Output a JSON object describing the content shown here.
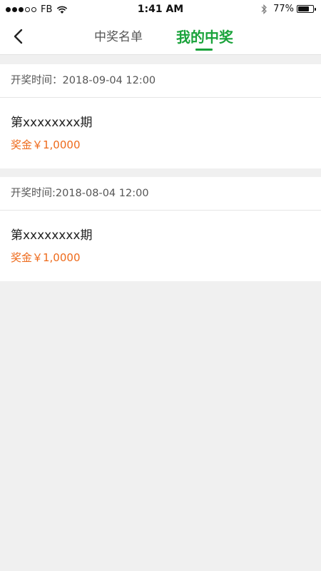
{
  "status_bar": {
    "carrier": "FB",
    "time": "1:41 AM",
    "battery_percent": "77%",
    "signal_bars_filled": 3,
    "signal_bars_total": 5,
    "battery_level": 0.77
  },
  "nav": {
    "back_icon": "chevron-left-icon",
    "tabs": [
      {
        "label": "中奖名单",
        "active": false
      },
      {
        "label": "我的中奖",
        "active": true
      }
    ],
    "accent_color": "#1aa33b"
  },
  "records": [
    {
      "draw_time_label": "开奖时间：2018-09-04 12:00",
      "period": "第xxxxxxxx期",
      "prize": "奖金￥1,0000"
    },
    {
      "draw_time_label": "开奖时间:2018-08-04 12:00",
      "period": "第xxxxxxxx期",
      "prize": "奖金￥1,0000"
    }
  ],
  "colors": {
    "prize": "#ee6a1b",
    "background": "#f0f0f0"
  }
}
